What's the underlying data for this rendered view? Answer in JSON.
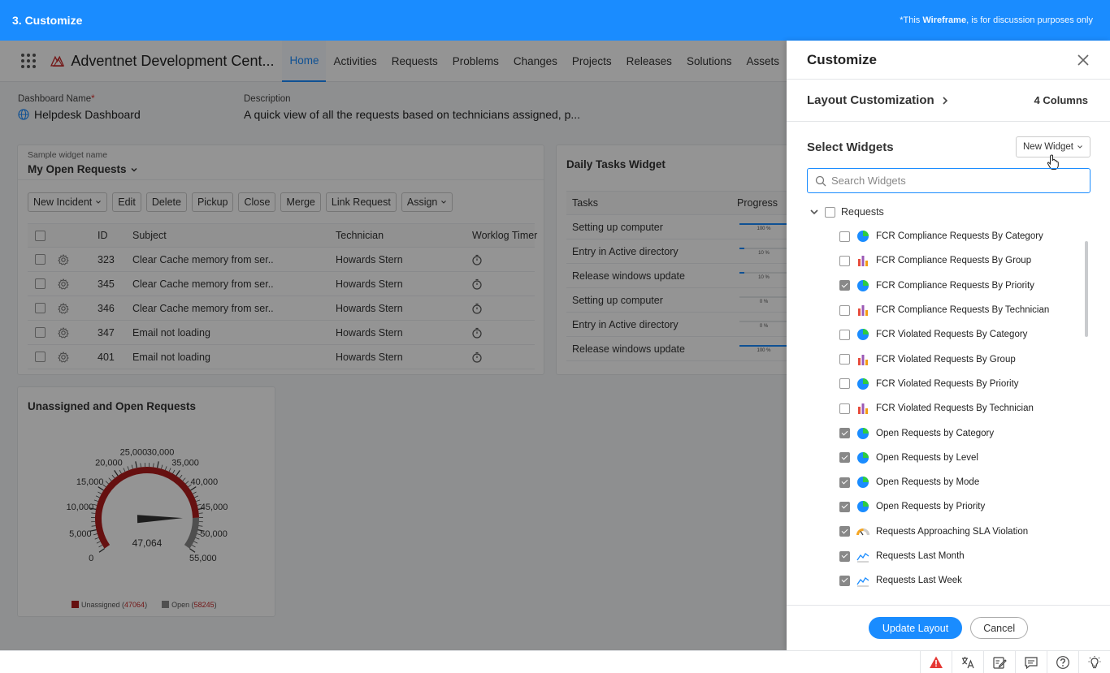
{
  "banner": {
    "title": "3. Customize",
    "note_prefix": "*This ",
    "note_bold": "Wireframe",
    "note_suffix": ", is for discussion purposes only"
  },
  "app": {
    "name": "Adventnet Development Cent...",
    "nav": [
      "Home",
      "Activities",
      "Requests",
      "Problems",
      "Changes",
      "Projects",
      "Releases",
      "Solutions",
      "Assets"
    ],
    "active_tab": "Home"
  },
  "dashboard": {
    "name_label": "Dashboard Name",
    "required_mark": "*",
    "name": "Helpdesk Dashboard",
    "description_label": "Description",
    "description": "A quick view of all the requests based on technicians assigned, p..."
  },
  "requests_widget": {
    "name_label": "Sample widget name",
    "name": "My Open Requests",
    "toolbar": [
      "New Incident",
      "Edit",
      "Delete",
      "Pickup",
      "Close",
      "Merge",
      "Link Request",
      "Assign"
    ],
    "columns": {
      "id": "ID",
      "subject": "Subject",
      "technician": "Technician",
      "timer": "Worklog Timer"
    },
    "rows": [
      {
        "id": "323",
        "subject": "Clear Cache memory from ser..",
        "technician": "Howards Stern"
      },
      {
        "id": "345",
        "subject": "Clear Cache memory from ser..",
        "technician": "Howards Stern"
      },
      {
        "id": "346",
        "subject": "Clear Cache memory from ser..",
        "technician": "Howards Stern"
      },
      {
        "id": "347",
        "subject": "Email not loading",
        "technician": "Howards Stern"
      },
      {
        "id": "401",
        "subject": "Email not loading",
        "technician": "Howards Stern"
      }
    ]
  },
  "tasks_widget": {
    "title": "Daily Tasks Widget",
    "columns": {
      "task": "Tasks",
      "progress": "Progress"
    },
    "rows": [
      {
        "task": "Setting up computer",
        "progress": 100,
        "label": "100 %"
      },
      {
        "task": "Entry in Active directory",
        "progress": 10,
        "label": "10 %"
      },
      {
        "task": "Release windows update",
        "progress": 10,
        "label": "10 %"
      },
      {
        "task": "Setting up computer",
        "progress": 0,
        "label": "0 %"
      },
      {
        "task": "Entry in Active directory",
        "progress": 0,
        "label": "0 %"
      },
      {
        "task": "Release windows update",
        "progress": 100,
        "label": "100 %"
      }
    ]
  },
  "gauge_widget": {
    "title": "Unassigned and Open Requests",
    "value_label": "47,064",
    "min": 0,
    "max": 55000,
    "value": 47064,
    "ticks": [
      "0",
      "5,000",
      "10,000",
      "15,000",
      "20,000",
      "25,000",
      "30,000",
      "35,000",
      "40,000",
      "45,000",
      "50,000",
      "55,000"
    ],
    "legend": [
      {
        "name": "Unassigned",
        "count": "47064",
        "color": "#b01c1c"
      },
      {
        "name": "Open",
        "count": "58245",
        "color": "#888888"
      }
    ]
  },
  "customize": {
    "title": "Customize",
    "layout_label": "Layout Customization",
    "layout_value": "4 Columns",
    "select_title": "Select Widgets",
    "new_widget": "New Widget",
    "search_placeholder": "Search Widgets",
    "group_label": "Requests",
    "items": [
      {
        "label": "FCR Compliance Requests By Category",
        "checked": false,
        "icon": "pie-chart-icon"
      },
      {
        "label": "FCR Compliance Requests By Group",
        "checked": false,
        "icon": "bar-chart-icon"
      },
      {
        "label": "FCR Compliance Requests By Priority",
        "checked": true,
        "icon": "pie-chart-icon"
      },
      {
        "label": "FCR Compliance Requests By Technician",
        "checked": false,
        "icon": "bar-chart-icon"
      },
      {
        "label": "FCR Violated Requests By Category",
        "checked": false,
        "icon": "pie-chart-icon"
      },
      {
        "label": "FCR Violated Requests By Group",
        "checked": false,
        "icon": "bar-chart-icon"
      },
      {
        "label": "FCR Violated Requests By Priority",
        "checked": false,
        "icon": "pie-chart-icon"
      },
      {
        "label": "FCR Violated Requests By Technician",
        "checked": false,
        "icon": "bar-chart-icon"
      },
      {
        "label": "Open Requests by Category",
        "checked": true,
        "icon": "pie-chart-icon"
      },
      {
        "label": "Open Requests by Level",
        "checked": true,
        "icon": "pie-chart-icon"
      },
      {
        "label": "Open Requests by Mode",
        "checked": true,
        "icon": "pie-chart-icon"
      },
      {
        "label": "Open Requests by Priority",
        "checked": true,
        "icon": "pie-chart-icon"
      },
      {
        "label": "Requests Approaching SLA Violation",
        "checked": true,
        "icon": "gauge-icon"
      },
      {
        "label": "Requests Last Month",
        "checked": true,
        "icon": "line-chart-icon"
      },
      {
        "label": "Requests Last Week",
        "checked": true,
        "icon": "line-chart-icon"
      }
    ],
    "update_button": "Update Layout",
    "cancel_button": "Cancel"
  },
  "colors": {
    "accent": "#1a8cff",
    "gauge_red": "#b01c1c",
    "gauge_gray": "#888888"
  }
}
